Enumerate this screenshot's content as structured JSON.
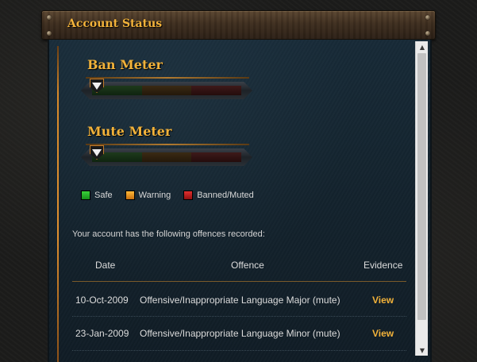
{
  "header": {
    "title": "Account Status"
  },
  "meters": [
    {
      "title": "Ban Meter"
    },
    {
      "title": "Mute Meter"
    }
  ],
  "legend": [
    {
      "label": "Safe",
      "color": "#22b422"
    },
    {
      "label": "Warning",
      "color": "#f0a020"
    },
    {
      "label": "Banned/Muted",
      "color": "#c81e1e"
    }
  ],
  "offences": {
    "intro": "Your account has the following offences recorded:",
    "columns": [
      "Date",
      "Offence",
      "Evidence"
    ],
    "rows": [
      {
        "date": "10-Oct-2009",
        "offence": "Offensive/Inappropriate Language Major (mute)",
        "evidence": "View"
      },
      {
        "date": "23-Jan-2009",
        "offence": "Offensive/Inappropriate Language Minor (mute)",
        "evidence": "View"
      }
    ]
  },
  "colors": {
    "accent": "#f2b23a",
    "panel": "#162836"
  },
  "scrollbar": {
    "up_icon": "▲",
    "down_icon": "▼"
  }
}
